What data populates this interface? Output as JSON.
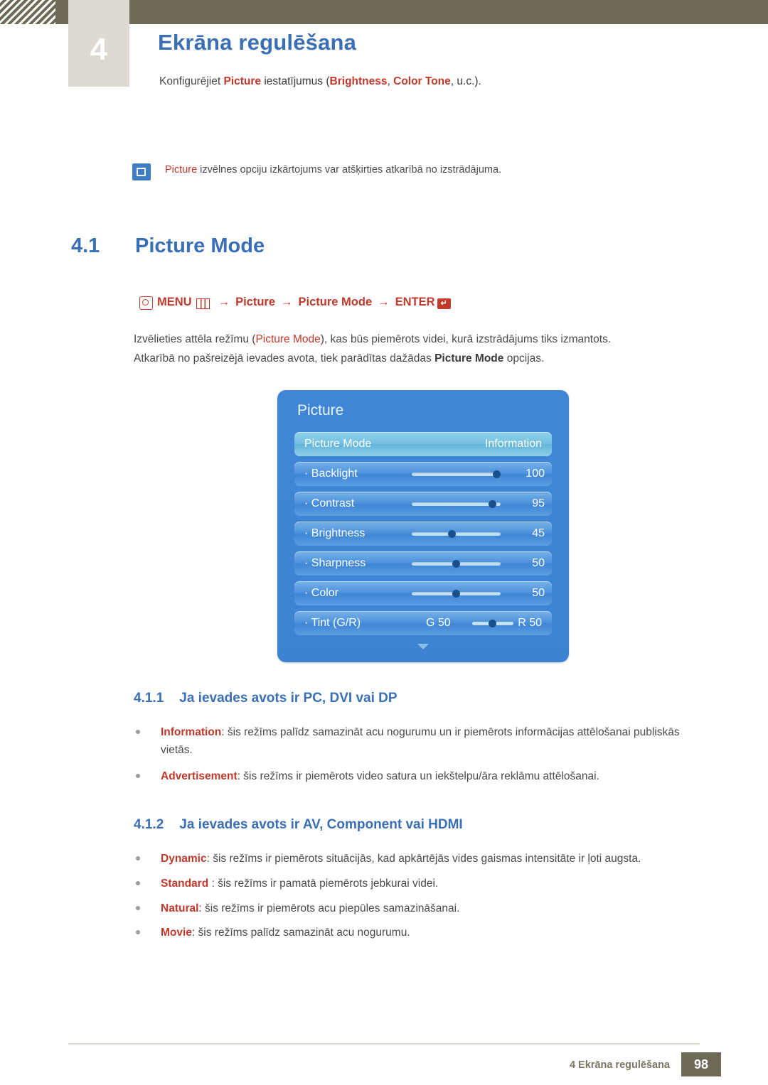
{
  "header": {
    "chapter_number": "4",
    "chapter_title": "Ekrāna regulēšana",
    "subtitle_before": "Konfigurējiet ",
    "subtitle_kw1": "Picture",
    "subtitle_mid": " iestatījumus (",
    "subtitle_kw2": "Brightness",
    "subtitle_sep": ", ",
    "subtitle_kw3": "Color Tone",
    "subtitle_after": ", u.c.)."
  },
  "note": {
    "icon": "note-icon",
    "keyword": "Picture",
    "text": " izvēlnes opciju izkārtojums var atšķirties atkarībā no izstrādājuma."
  },
  "section": {
    "number": "4.1",
    "title": "Picture Mode"
  },
  "menupath": {
    "menu": "MENU",
    "arrow1": "→",
    "item1": "Picture",
    "arrow2": "→",
    "item2": "Picture Mode",
    "arrow3": "→",
    "enter": "ENTER"
  },
  "intro": {
    "l1_a": "Izvēlieties attēla režīmu (",
    "l1_kw": "Picture Mode",
    "l1_b": "), kas būs piemērots videi, kurā izstrādājums tiks izmantots.",
    "l2_a": "Atkarībā no pašreizējā ievades avota, tiek parādītas dažādas ",
    "l2_kw": "Picture Mode",
    "l2_b": " opcijas."
  },
  "osd": {
    "title": "Picture",
    "rows": [
      {
        "label": "Picture Mode",
        "value": "Information",
        "type": "text"
      },
      {
        "label": "· Backlight",
        "value": "100",
        "type": "slider",
        "fill": 100
      },
      {
        "label": "· Contrast",
        "value": "95",
        "type": "slider",
        "fill": 95
      },
      {
        "label": "· Brightness",
        "value": "45",
        "type": "slider",
        "fill": 45
      },
      {
        "label": "· Sharpness",
        "value": "50",
        "type": "slider",
        "fill": 50
      },
      {
        "label": "· Color",
        "value": "50",
        "type": "slider",
        "fill": 50
      }
    ],
    "tint_row": {
      "label": "· Tint (G/R)",
      "left": "G 50",
      "right": "R 50"
    }
  },
  "sub1": {
    "number": "4.1.1",
    "title": "Ja ievades avots ir PC, DVI vai DP",
    "bullets": [
      {
        "kw": "Information",
        "text": ": šis režīms palīdz samazināt acu nogurumu un ir piemērots informācijas attēlošanai publiskās vietās."
      },
      {
        "kw": "Advertisement",
        "text": ": šis režīms ir piemērots video satura un iekštelpu/āra reklāmu attēlošanai."
      }
    ]
  },
  "sub2": {
    "number": "4.1.2",
    "title": "Ja ievades avots ir AV, Component vai HDMI",
    "bullets": [
      {
        "kw": "Dynamic",
        "text": ": šis režīms ir piemērots situācijās, kad apkārtējās vides gaismas intensitāte ir ļoti augsta."
      },
      {
        "kw": "Standard",
        "text": " : šis režīms ir pamatā piemērots jebkurai videi."
      },
      {
        "kw": "Natural",
        "text": ": šis režīms ir piemērots acu piepūles samazināšanai."
      },
      {
        "kw": "Movie",
        "text": ": šis režīms palīdz samazināt acu nogurumu."
      }
    ]
  },
  "footer": {
    "text": "4 Ekrāna regulēšana",
    "page": "98"
  },
  "colors": {
    "band": "#6e6a57",
    "heading_blue": "#3a6fb5",
    "keyword_red": "#c0392b",
    "osd_blue": "#3f86d6"
  }
}
